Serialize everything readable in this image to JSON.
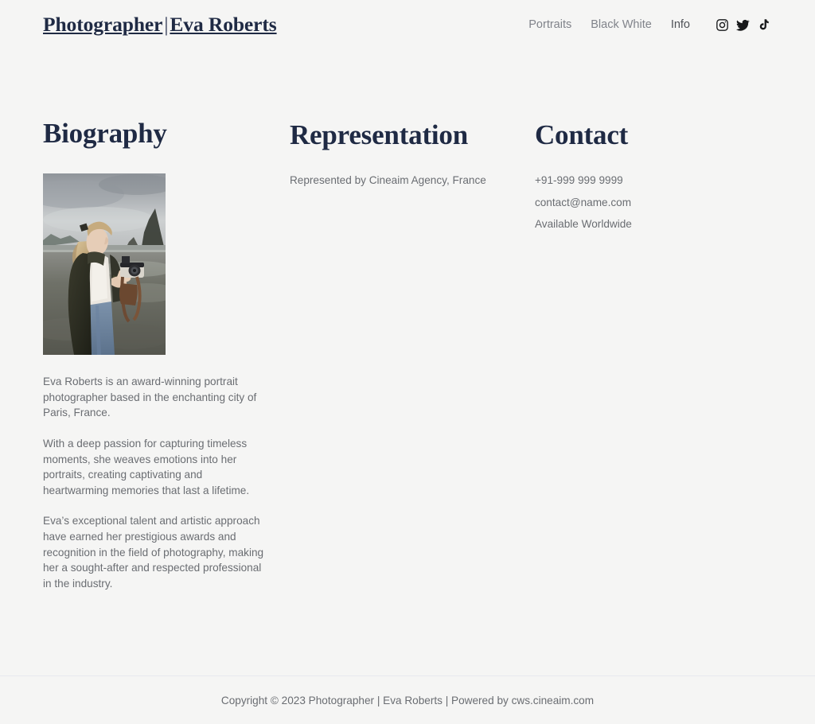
{
  "theme": {
    "page_background": "#f5f5f4",
    "heading_color": "#1f2a44",
    "body_text_color": "#6a6d72",
    "nav_inactive_color": "#80838a",
    "nav_active_color": "#4f5257",
    "divider_color": "#e8e9ee",
    "icon_color": "#17181a"
  },
  "header": {
    "brand": {
      "name_primary": "Photographer",
      "separator": "|",
      "name_secondary": "Eva Roberts"
    },
    "nav": [
      {
        "label": "Portraits",
        "active": false,
        "name": "nav-link-portraits"
      },
      {
        "label": "Black White",
        "active": false,
        "name": "nav-link-black-white"
      },
      {
        "label": "Info",
        "active": true,
        "name": "nav-link-info"
      }
    ],
    "social": [
      {
        "icon": "instagram-icon",
        "label": "Instagram"
      },
      {
        "icon": "twitter-icon",
        "label": "Twitter"
      },
      {
        "icon": "tiktok-icon",
        "label": "TikTok"
      }
    ]
  },
  "main": {
    "biography": {
      "title": "Biography",
      "photo": {
        "icon": "portrait-photograph",
        "alt": "Photographer holding a camera on an overcast beach with a sea stack in the background"
      },
      "paragraphs": [
        "Eva Roberts is an award-winning portrait photographer based in the enchanting city of Paris, France.",
        "With a deep passion for capturing timeless moments, she weaves emotions into her portraits, creating captivating and heartwarming memories that last a lifetime.",
        "Eva’s exceptional talent and artistic approach have earned her prestigious awards and recognition in the field of photography, making her a sought-after and respected professional in the industry."
      ]
    },
    "representation": {
      "title": "Representation",
      "text": "Represented by Cineaim Agency, France"
    },
    "contact": {
      "title": "Contact",
      "items": [
        "+91-999 999 9999",
        "contact@name.com",
        "Available Worldwide"
      ]
    }
  },
  "footer": {
    "text": "Copyright © 2023 Photographer | Eva Roberts | Powered by cws.cineaim.com"
  }
}
